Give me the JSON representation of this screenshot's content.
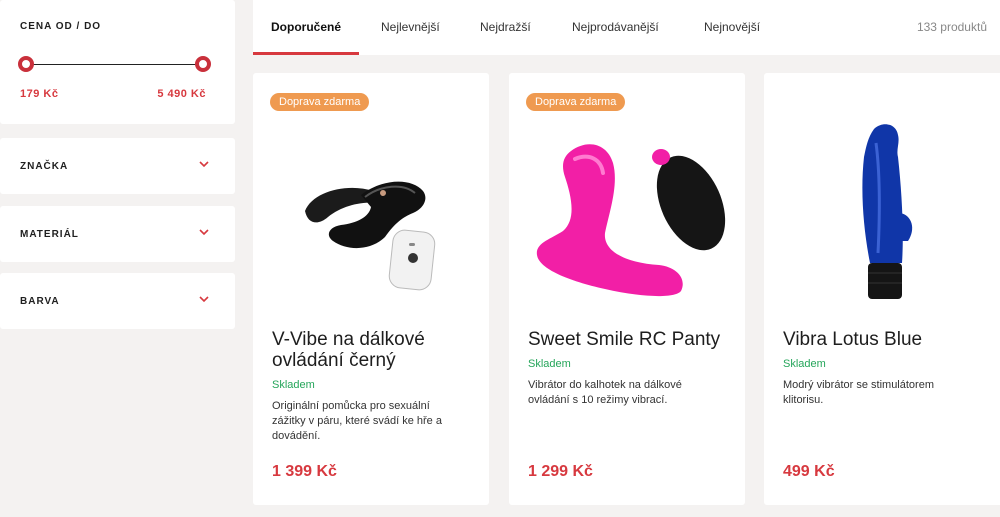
{
  "filters": {
    "price": {
      "title": "CENA OD / DO",
      "min_label": "179 Kč",
      "max_label": "5 490 Kč",
      "min_value": 179,
      "max_value": 5490
    },
    "groups": [
      {
        "label": "ZNAČKA",
        "icon": "chevron-down-icon"
      },
      {
        "label": "MATERIÁL",
        "icon": "chevron-down-icon"
      },
      {
        "label": "BARVA",
        "icon": "chevron-down-icon"
      }
    ]
  },
  "sort_tabs": [
    {
      "label": "Doporučené",
      "active": true
    },
    {
      "label": "Nejlevnější",
      "active": false
    },
    {
      "label": "Nejdražší",
      "active": false
    },
    {
      "label": "Nejprodávanější",
      "active": false
    },
    {
      "label": "Nejnovější",
      "active": false
    }
  ],
  "product_count": "133 produktů",
  "products": [
    {
      "badge": "Doprava zdarma",
      "name": "V-Vibe na dálkové ovládání černý",
      "stock": "Skladem",
      "description": "Originální pomůcka pro sexuální zážitky v páru, které svádí ke hře a dovádění.",
      "price": "1 399 Kč",
      "image": "black-couples-vibrator-with-remote"
    },
    {
      "badge": "Doprava zdarma",
      "name": "Sweet Smile RC Panty",
      "stock": "Skladem",
      "description": "Vibrátor do kalhotek na dálkové ovládání s 10 režimy vibrací.",
      "price": "1 299 Kč",
      "image": "pink-panty-vibrator-with-remote"
    },
    {
      "badge": "",
      "name": "Vibra Lotus Blue",
      "stock": "Skladem",
      "description": "Modrý vibrátor se stimulátorem klitorisu.",
      "price": "499 Kč",
      "image": "blue-rabbit-vibrator"
    }
  ],
  "colors": {
    "accent": "#d7393f",
    "badge": "#ef9a50",
    "stock": "#25a55a",
    "background": "#f4f2f1"
  }
}
